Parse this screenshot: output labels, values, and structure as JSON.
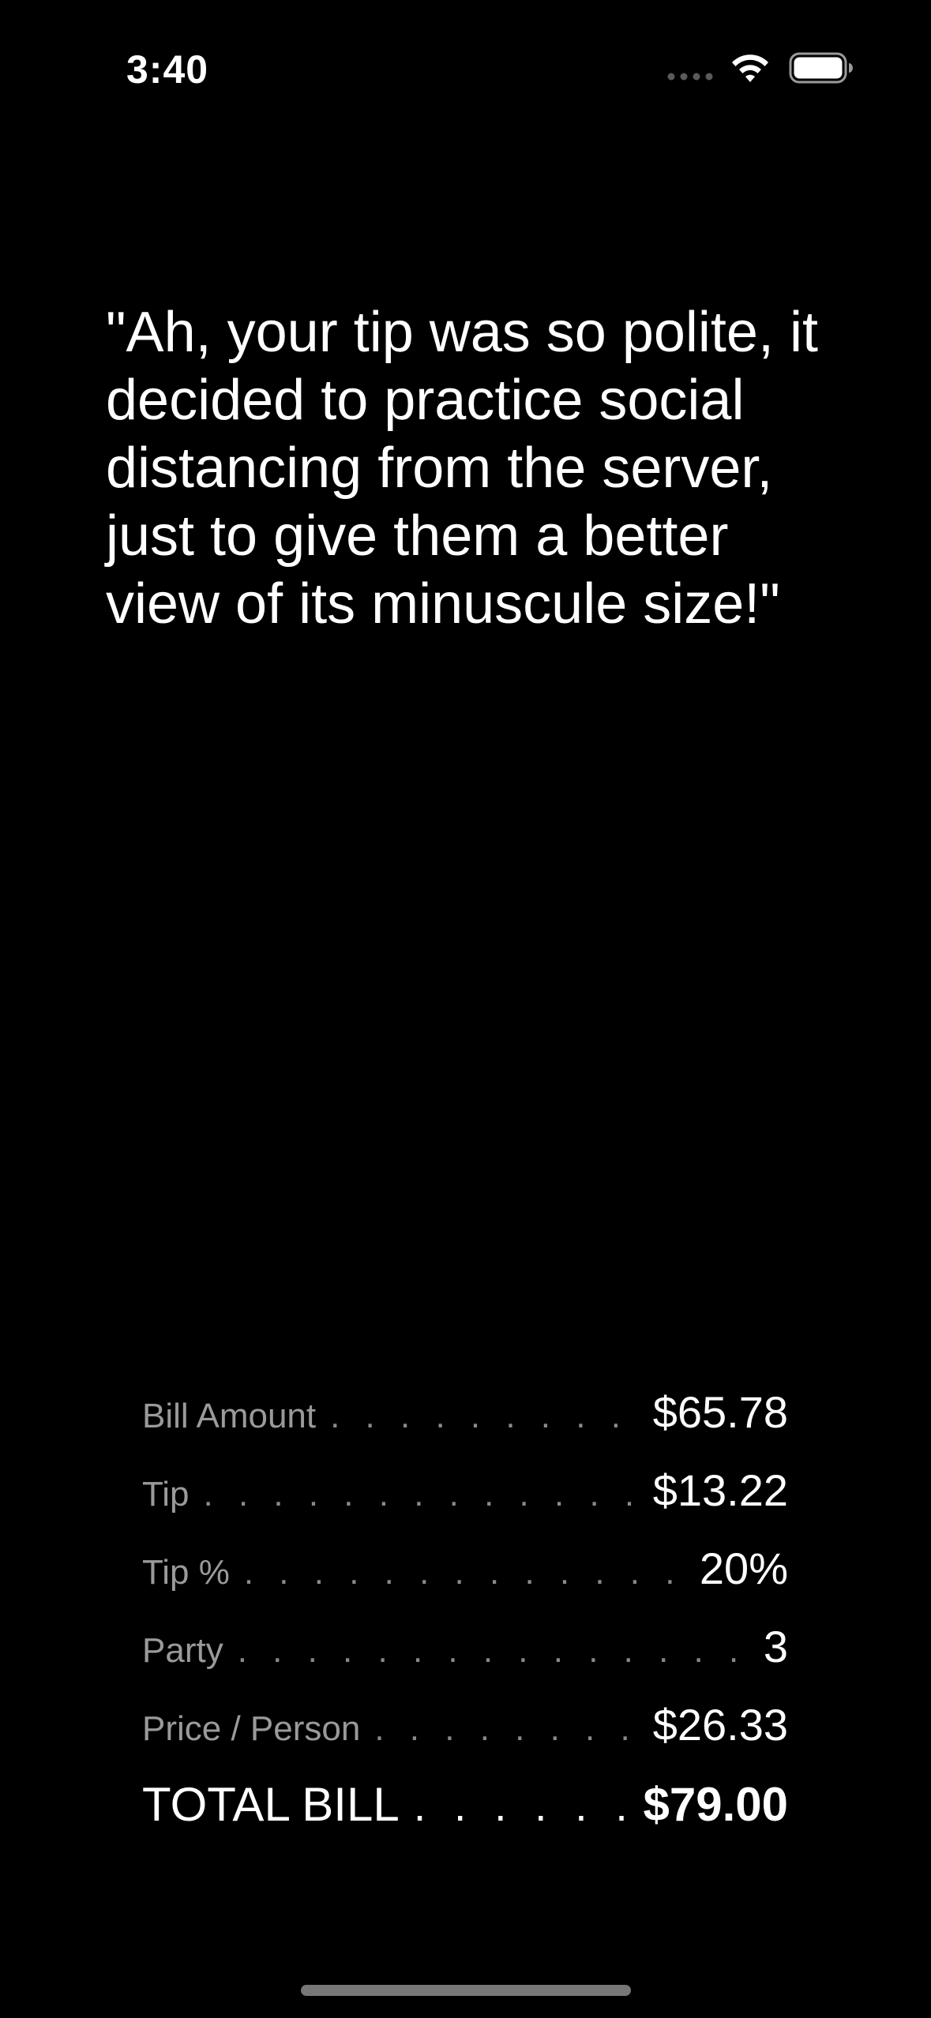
{
  "status_bar": {
    "time": "3:40",
    "icons": [
      "cellular-signal-icon",
      "wifi-icon",
      "battery-icon"
    ]
  },
  "quote": {
    "text": "\"Ah, your tip was so polite, it decided to practice social distancing from the server, just to give them a better view of its minuscule size!\""
  },
  "summary": {
    "rows": [
      {
        "label": "Bill Amount",
        "value": "$65.78"
      },
      {
        "label": "Tip",
        "value": "$13.22"
      },
      {
        "label": "Tip %",
        "value": "20%"
      },
      {
        "label": "Party",
        "value": "3"
      },
      {
        "label": "Price / Person",
        "value": "$26.33"
      }
    ],
    "total": {
      "label": "TOTAL BILL",
      "value": "$79.00"
    }
  },
  "colors": {
    "background": "#000000",
    "text": "#ffffff",
    "label": "#9a9a9a"
  }
}
